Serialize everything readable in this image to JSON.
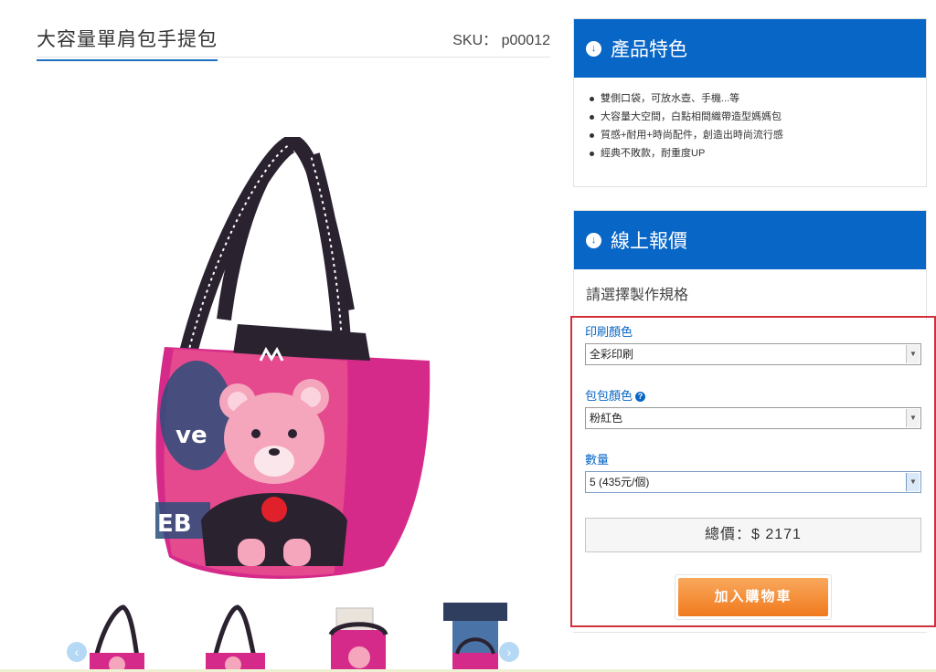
{
  "product": {
    "title": "大容量單肩包手提包",
    "sku": "SKU： p00012"
  },
  "features": {
    "heading": "產品特色",
    "items": [
      "雙側口袋，可放水壺、手機...等",
      "大容量大空間，白點相間織帶造型媽媽包",
      "質感+耐用+時尚配件，創造出時尚流行感",
      "經典不敗款，耐重度UP"
    ]
  },
  "quote": {
    "heading": "線上報價",
    "spec_heading": "請選擇製作規格",
    "print_color_label": "印刷顏色",
    "print_color_value": "全彩印刷",
    "bag_color_label": "包包顏色",
    "bag_color_value": "粉紅色",
    "quantity_label": "數量",
    "quantity_value": "5 (435元/個)",
    "total": "總價：$ 2171",
    "add_to_cart": "加入購物車"
  },
  "colors": {
    "accent": "#0866c6",
    "bag_pink": "#d62a8a",
    "strap": "#2b2230",
    "cart_orange": "#f07a1e",
    "highlight_border": "#d22f3a"
  },
  "icons": {
    "section_icon": "arrow-circle-down-icon",
    "help": "question-circle-icon",
    "prev": "chevron-left-icon",
    "next": "chevron-right-icon"
  }
}
